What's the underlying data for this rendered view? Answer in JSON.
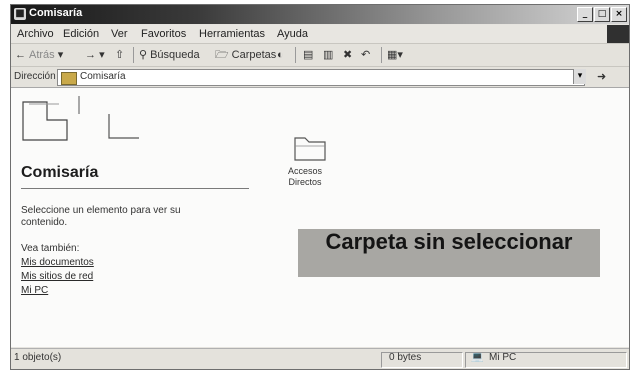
{
  "window": {
    "title": "Comisaría",
    "minimize": "_",
    "maximize": "□",
    "close": "×"
  },
  "menu": [
    "Archivo",
    "Edición",
    "Ver",
    "Favoritos",
    "Herramientas",
    "Ayuda"
  ],
  "toolbar": {
    "back": "Atrás",
    "search": "Búsqueda",
    "folders": "Carpetas"
  },
  "address": {
    "label": "Dirección",
    "value": "Comisaría"
  },
  "panel": {
    "title": "Comisaría",
    "description": "Seleccione un elemento para ver su contenido.",
    "see_also": "Vea también:",
    "links": [
      "Mis documentos",
      "Mis sitios de red",
      "Mi PC"
    ]
  },
  "items": [
    {
      "label": "Accesos Directos",
      "icon": "folder-icon"
    }
  ],
  "banner": "Carpeta sin seleccionar",
  "status": {
    "objects": "1 objeto(s)",
    "size": "0 bytes",
    "location": "Mi PC"
  },
  "colors": {
    "titlebar": "#181818",
    "banner": "#a8a7a3",
    "chrome": "#e4e2dc"
  }
}
